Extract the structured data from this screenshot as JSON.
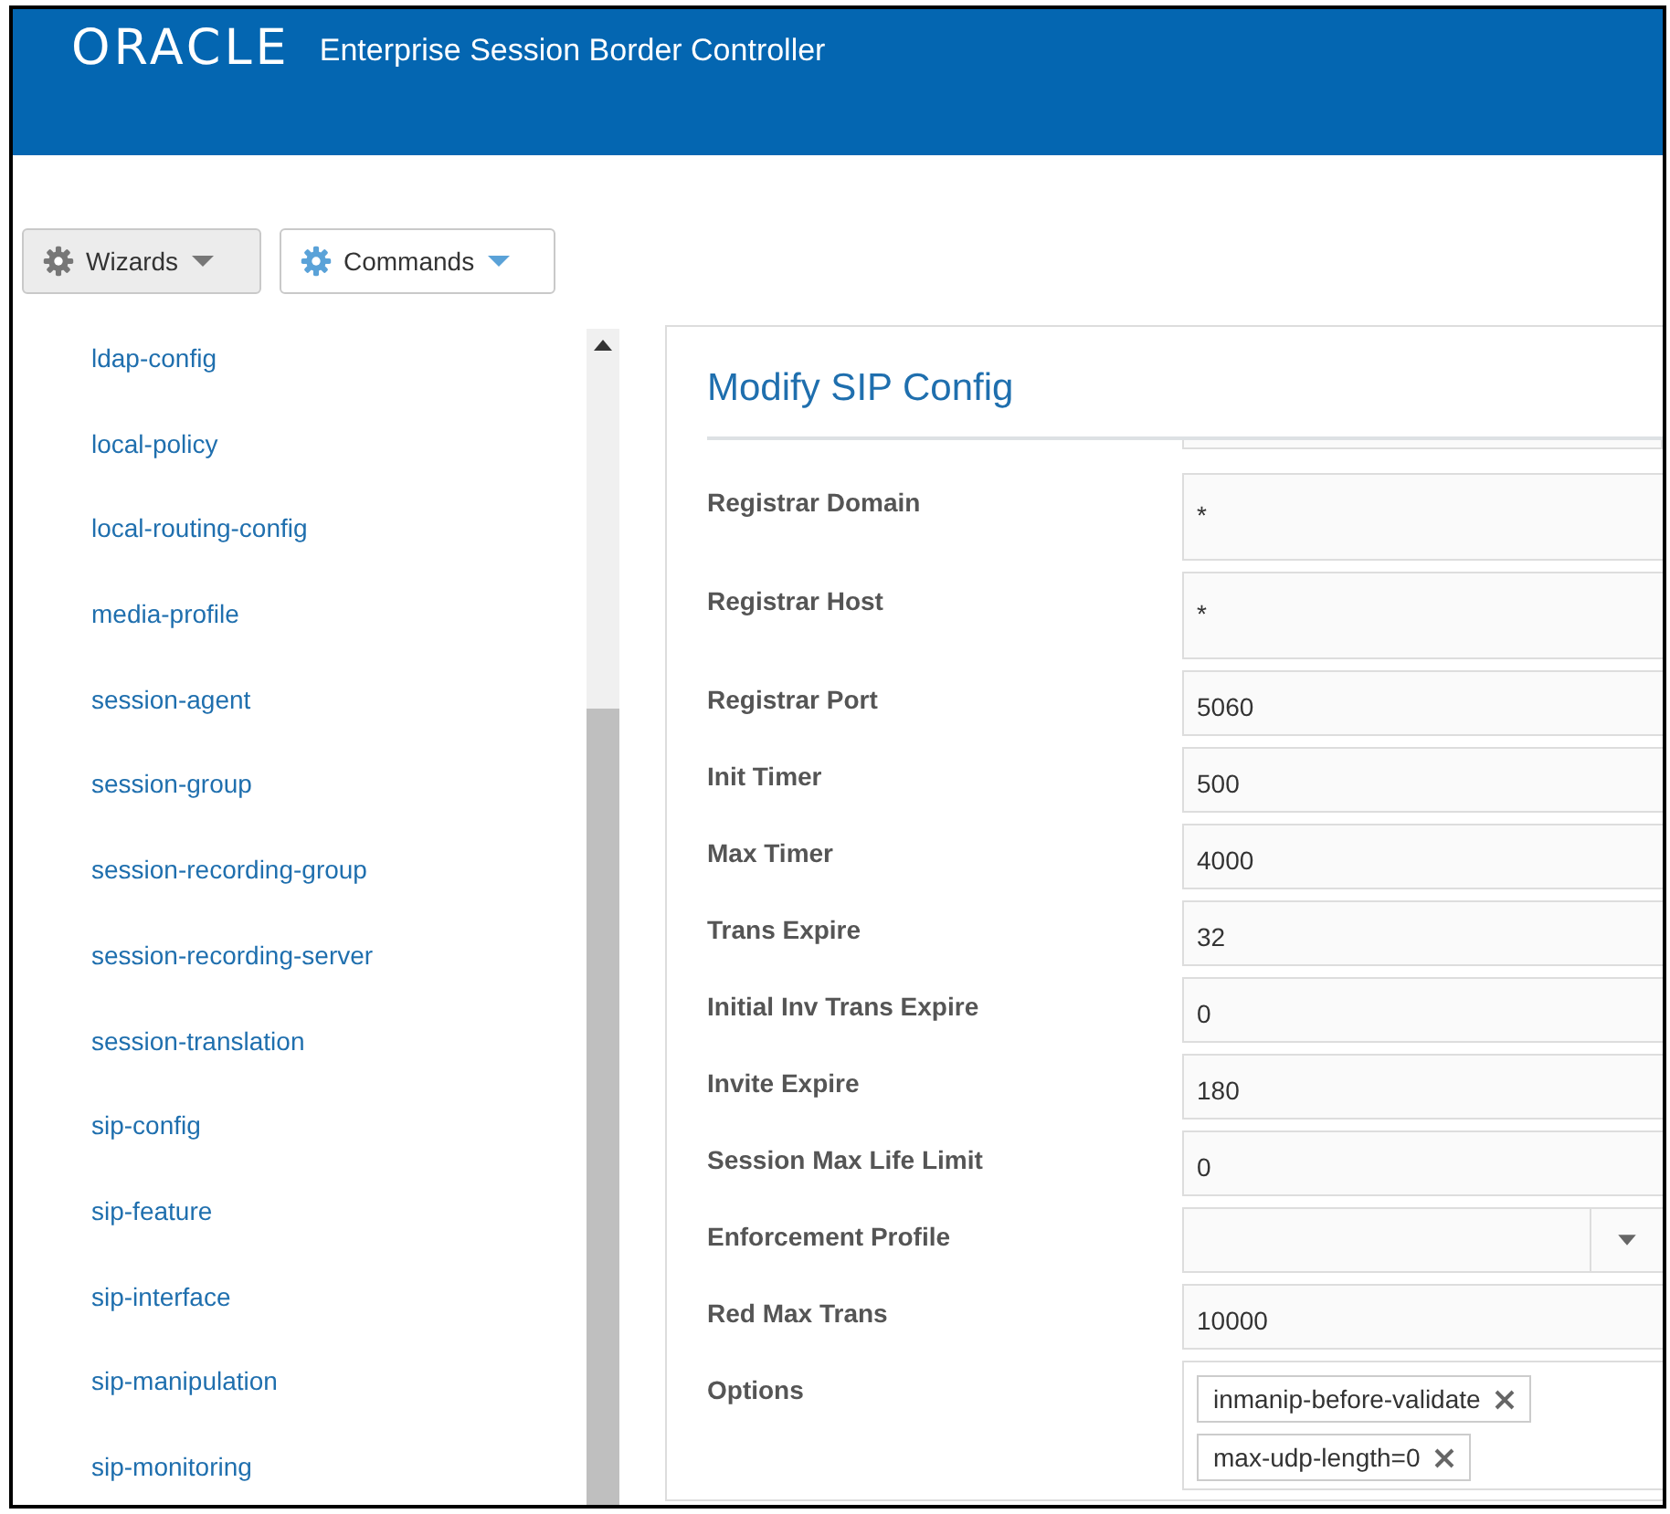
{
  "header": {
    "logo": "ORACLE",
    "product": "Enterprise Session Border Controller"
  },
  "toolbar": [
    {
      "label": "Wizards",
      "kind": "grey"
    },
    {
      "label": "Commands",
      "kind": "blue"
    }
  ],
  "sidebar": {
    "items": [
      {
        "label": "ldap-config"
      },
      {
        "label": "local-policy"
      },
      {
        "label": "local-routing-config"
      },
      {
        "label": "media-profile"
      },
      {
        "label": "session-agent"
      },
      {
        "label": "session-group"
      },
      {
        "label": "session-recording-group"
      },
      {
        "label": "session-recording-server"
      },
      {
        "label": "session-translation"
      },
      {
        "label": "sip-config"
      },
      {
        "label": "sip-feature"
      },
      {
        "label": "sip-interface"
      },
      {
        "label": "sip-manipulation"
      },
      {
        "label": "sip-monitoring"
      }
    ]
  },
  "form": {
    "title": "Modify SIP Config",
    "fields": [
      {
        "label": "Registrar Domain",
        "kind": "text",
        "value": "*"
      },
      {
        "label": "Registrar Host",
        "kind": "text",
        "value": "*"
      },
      {
        "label": "Registrar Port",
        "kind": "text",
        "value": "5060"
      },
      {
        "label": "Init Timer",
        "kind": "text",
        "value": "500"
      },
      {
        "label": "Max Timer",
        "kind": "text",
        "value": "4000"
      },
      {
        "label": "Trans Expire",
        "kind": "text",
        "value": "32"
      },
      {
        "label": "Initial Inv Trans Expire",
        "kind": "text",
        "value": "0"
      },
      {
        "label": "Invite Expire",
        "kind": "text",
        "value": "180"
      },
      {
        "label": "Session Max Life Limit",
        "kind": "text",
        "value": "0"
      },
      {
        "label": "Enforcement Profile",
        "kind": "select"
      },
      {
        "label": "Red Max Trans",
        "kind": "text",
        "value": "10000"
      },
      {
        "label": "Options",
        "kind": "tags",
        "tags": [
          "inmanip-before-validate",
          "max-udp-length=0"
        ]
      }
    ]
  }
}
